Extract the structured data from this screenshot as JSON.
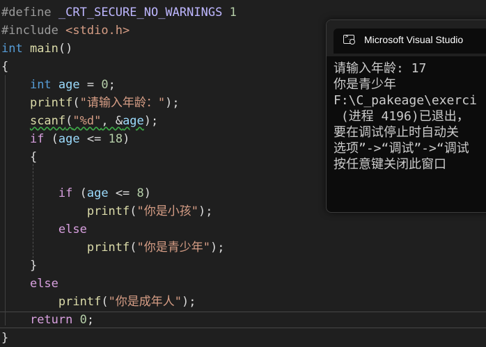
{
  "editor": {
    "l1_dir": "#define",
    "l1_macro": "_CRT_SECURE_NO_WARNINGS",
    "l1_num": "1",
    "l2_dir": "#include",
    "l2_hdr": "<stdio.h>",
    "l3_type": "int",
    "l3_fn": "main",
    "l3_paren": "()",
    "l4": "{",
    "l5_type": "int",
    "l5_var": "age",
    "l5_op": " = ",
    "l5_num": "0",
    "l5_end": ";",
    "l6_fn": "printf",
    "l6_open": "(",
    "l6_str": "\"请输入年龄：\"",
    "l6_end": ");",
    "l7_fn": "scanf",
    "l7_open": "(",
    "l7_str": "\"%d\"",
    "l7_mid": ", &",
    "l7_var": "age",
    "l7_end": ");",
    "l8_kw": "if",
    "l8_open": " (",
    "l8_var": "age",
    "l8_op": " <= ",
    "l8_num": "18",
    "l8_end": ")",
    "l9": "{",
    "l11_kw": "if",
    "l11_open": " (",
    "l11_var": "age",
    "l11_op": " <= ",
    "l11_num": "8",
    "l11_end": ")",
    "l12_fn": "printf",
    "l12_open": "(",
    "l12_str": "\"你是小孩\"",
    "l12_end": ");",
    "l13_kw": "else",
    "l14_fn": "printf",
    "l14_open": "(",
    "l14_str": "\"你是青少年\"",
    "l14_end": ");",
    "l15": "}",
    "l16_kw": "else",
    "l17_fn": "printf",
    "l17_open": "(",
    "l17_str": "\"你是成年人\"",
    "l17_end": ");",
    "l18_kw": "return",
    "l18_num": "0",
    "l18_end": ";",
    "l19": "}"
  },
  "console": {
    "title": "Microsoft Visual Studio",
    "icon": "console-icon",
    "lines": [
      "请输入年龄: 17",
      "你是青少年",
      "F:\\C_pakeage\\exerci",
      " (进程 4196)已退出，",
      "要在调试停止时自动关",
      "选项”->“调试”->“调试",
      "按任意键关闭此窗口"
    ]
  },
  "colors": {
    "background": "#1f1f1f",
    "keyword": "#569cd6",
    "control": "#d8a0df",
    "function": "#dcdcaa",
    "string": "#d69d85",
    "number": "#b5cea8",
    "variable": "#9cdcfe",
    "preprocessor": "#9b9b9b",
    "macro": "#beb7ff"
  }
}
